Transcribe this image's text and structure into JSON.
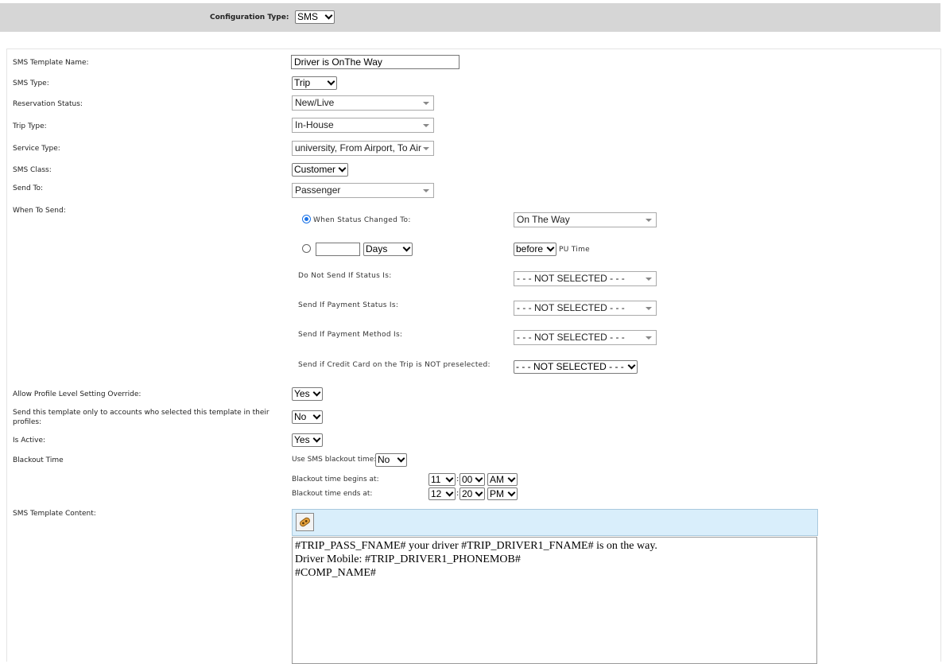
{
  "config": {
    "label": "Configuration Type:",
    "value": "SMS"
  },
  "form": {
    "template_name": {
      "label": "SMS Template Name:",
      "value": "Driver is OnThe Way"
    },
    "sms_type": {
      "label": "SMS Type:",
      "value": "Trip"
    },
    "reservation_status": {
      "label": "Reservation Status:",
      "value": "New/Live"
    },
    "trip_type": {
      "label": "Trip Type:",
      "value": "In-House"
    },
    "service_type": {
      "label": "Service Type:",
      "value": "university, From Airport, To Air"
    },
    "sms_class": {
      "label": "SMS Class:",
      "value": "Customer"
    },
    "send_to": {
      "label": "Send To:",
      "value": "Passenger"
    },
    "when_to_send": {
      "label": "When To Send:",
      "status_changed": {
        "label": "When Status Changed To:",
        "value": "On The Way",
        "selected": true
      },
      "relative": {
        "amount": "",
        "unit": "Days",
        "direction": "before",
        "suffix": "PU Time",
        "selected": false
      },
      "do_not_send_status": {
        "label": "Do Not Send If Status Is:",
        "value": "- - - NOT SELECTED - - -"
      },
      "payment_status": {
        "label": "Send If Payment Status Is:",
        "value": "- - - NOT SELECTED - - -"
      },
      "payment_method": {
        "label": "Send If Payment Method Is:",
        "value": "- - - NOT SELECTED - - -"
      },
      "credit_card": {
        "label": "Send if Credit Card on the Trip is NOT preselected:",
        "value": "- - - NOT SELECTED - - -"
      }
    },
    "allow_override": {
      "label": "Allow Profile Level Setting Override:",
      "value": "Yes"
    },
    "only_selected_accounts": {
      "label": "Send this template only to accounts who selected this template in their profiles:",
      "value": "No"
    },
    "is_active": {
      "label": "Is Active:",
      "value": "Yes"
    },
    "blackout": {
      "label": "Blackout Time",
      "use_label": "Use SMS blackout time:",
      "use_value": "No",
      "begins_label": "Blackout time begins at:",
      "begins_hour": "11",
      "begins_min": "00",
      "begins_ampm": "AM",
      "ends_label": "Blackout time ends at:",
      "ends_hour": "12",
      "ends_min": "20",
      "ends_ampm": "PM",
      "sep": ":"
    },
    "content": {
      "label": "SMS Template Content:",
      "lines": [
        "#TRIP_PASS_FNAME# your driver  #TRIP_DRIVER1_FNAME# is on the way.",
        "Driver Mobile:  #TRIP_DRIVER1_PHONEMOB#",
        "#COMP_NAME#"
      ],
      "toolbar_icon": "insert-field-icon"
    }
  }
}
